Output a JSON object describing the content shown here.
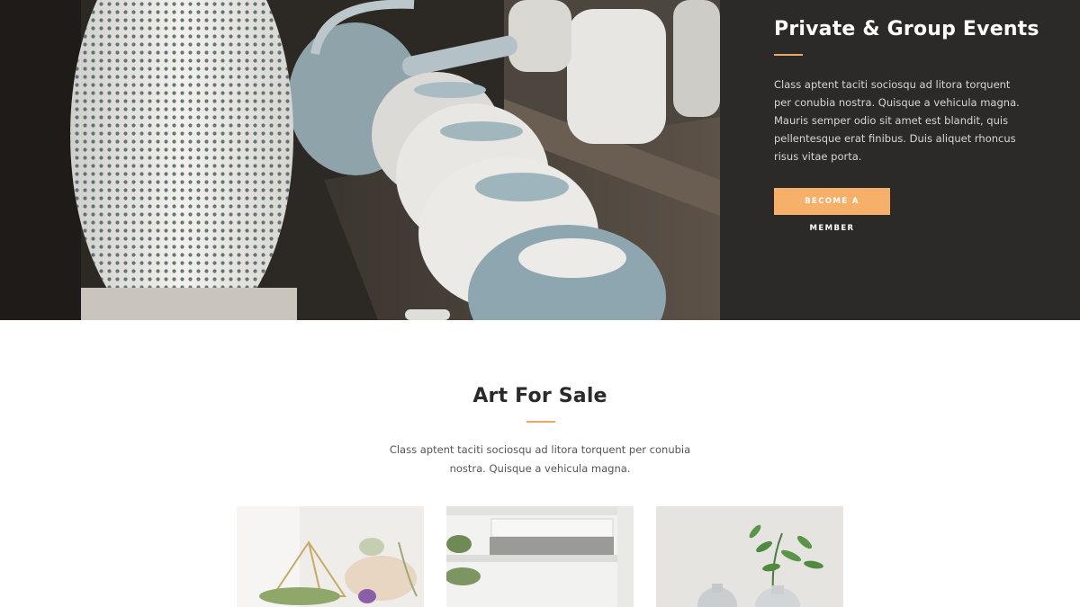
{
  "hero": {
    "image_alt": "Ceramic pottery on shelf",
    "panel": {
      "title": "Private & Group Events",
      "body": "Class aptent taciti sociosqu ad litora torquent per conubia nostra. Quisque a vehicula magna. Mauris semper odio sit amet est blandit, quis pellentesque erat finibus. Duis aliquet rhoncus risus vitae porta.",
      "button_label": "BECOME A MEMBER"
    }
  },
  "section": {
    "title": "Art For Sale",
    "text": "Class aptent taciti sociosqu ad litora torquent per conubia nostra. Quisque a vehicula magna.",
    "cards": [
      {
        "alt": "Geometric terrarium with air plants"
      },
      {
        "alt": "Stacked books on white shelf"
      },
      {
        "alt": "Ceramic vases with green sprigs"
      }
    ]
  },
  "colors": {
    "accent": "#f7b06a",
    "panel_bg": "#2b2a28",
    "heading": "#2a2a2a",
    "body_text": "#555555"
  }
}
